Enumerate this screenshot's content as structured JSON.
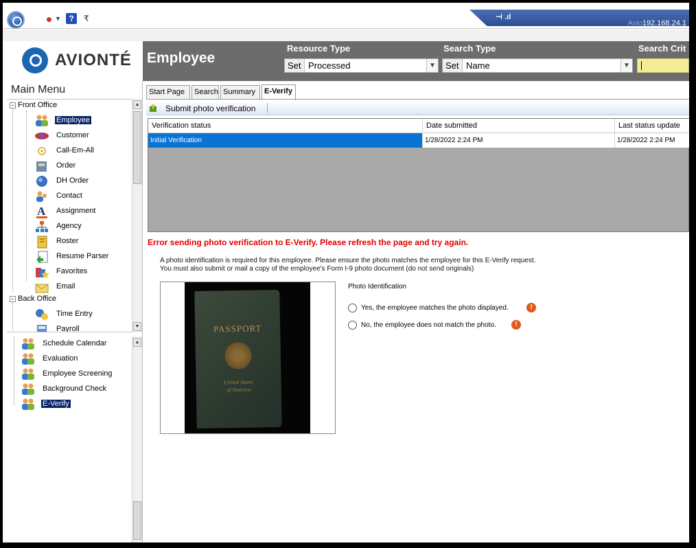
{
  "titlebar": {
    "remote_ip": "192.168.24.1",
    "remote_label": "Avio",
    "quick_access_help": "?"
  },
  "brand": {
    "name": "AVIONTÉ"
  },
  "header": {
    "title": "Employee",
    "resource_type": {
      "label": "Resource Type",
      "set": "Set",
      "value": "Processed"
    },
    "search_type": {
      "label": "Search Type",
      "set": "Set",
      "value": "Name"
    },
    "search_criteria": {
      "label": "Search Crit",
      "value": ""
    }
  },
  "sidebar": {
    "title": "Main Menu",
    "front_office_label": "Front Office",
    "back_office_label": "Back Office",
    "front_items": [
      {
        "label": "Employee",
        "icon": "people-icon",
        "selected": true
      },
      {
        "label": "Customer",
        "icon": "customer-icon"
      },
      {
        "label": "Call-Em-All",
        "icon": "phone-icon"
      },
      {
        "label": "Order",
        "icon": "order-icon"
      },
      {
        "label": "DH Order",
        "icon": "dh-order-icon"
      },
      {
        "label": "Contact",
        "icon": "contact-icon"
      },
      {
        "label": "Assignment",
        "icon": "assignment-icon"
      },
      {
        "label": "Agency",
        "icon": "agency-icon"
      },
      {
        "label": "Roster",
        "icon": "roster-icon"
      },
      {
        "label": "Resume Parser",
        "icon": "resume-parser-icon"
      },
      {
        "label": "Favorites",
        "icon": "favorites-icon"
      },
      {
        "label": "Email",
        "icon": "email-icon"
      }
    ],
    "back_items": [
      {
        "label": "Time Entry",
        "icon": "time-entry-icon"
      },
      {
        "label": "Payroll",
        "icon": "payroll-icon"
      }
    ],
    "sub_items": [
      {
        "label": "Schedule Calendar",
        "icon": "people-icon"
      },
      {
        "label": "Evaluation",
        "icon": "people-icon"
      },
      {
        "label": "Employee Screening",
        "icon": "people-icon"
      },
      {
        "label": "Background Check",
        "icon": "people-icon"
      },
      {
        "label": "E-Verify",
        "icon": "people-icon",
        "selected": true
      }
    ]
  },
  "tabs": [
    {
      "label": "Start Page"
    },
    {
      "label": "Search"
    },
    {
      "label": "Summary"
    },
    {
      "label": "E-Verify",
      "active": true
    }
  ],
  "toolbar": {
    "submit_label": "Submit photo verification"
  },
  "grid": {
    "columns": [
      "Verification status",
      "Date submitted",
      "Last status update"
    ],
    "rows": [
      [
        "Initial Verification",
        "1/28/2022 2:24 PM",
        "1/28/2022 2:24 PM"
      ]
    ]
  },
  "error": "Error sending photo verification to E-Verify.  Please refresh the page and try again.",
  "info": {
    "line1": "A photo identification is required for this employee. Please ensure the photo matches the employee for this E-Verify request.",
    "line2": "You must also submit or mail a copy of the employee's Form I-9 photo document (do not send originals)"
  },
  "passport": {
    "title": "PASSPORT",
    "line1": "United States",
    "line2": "of America"
  },
  "photo_id": {
    "label": "Photo Identification",
    "option_yes": "Yes, the employee matches the photo displayed.",
    "option_no": "No, the employee does not match the photo."
  },
  "colors": {
    "header_bg": "#6c6c6c",
    "selection": "#0a246a",
    "grid_selected_row": "#0a74d4",
    "error_text": "#e00000",
    "search_criteria_bg": "#f5ec98"
  }
}
